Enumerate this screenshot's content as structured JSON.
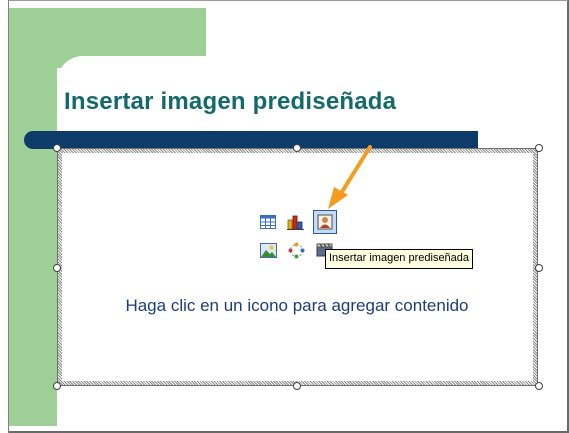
{
  "slide": {
    "title": "Insertar imagen prediseñada",
    "placeholder_text": "Haga clic en un icono para agregar contenido"
  },
  "content_icons": [
    {
      "name": "table",
      "icon": "table-icon"
    },
    {
      "name": "chart",
      "icon": "chart-icon"
    },
    {
      "name": "clip-art",
      "icon": "clip-art-icon"
    },
    {
      "name": "picture",
      "icon": "picture-icon"
    },
    {
      "name": "diagram",
      "icon": "diagram-icon"
    },
    {
      "name": "media",
      "icon": "media-clip-icon"
    }
  ],
  "tooltip": {
    "text": "Insertar imagen prediseñada"
  },
  "colors": {
    "accent_green": "#9ecf97",
    "title_teal": "#146a6a",
    "bar_navy": "#0e3c6a",
    "body_text_blue": "#1c3d78",
    "arrow_orange": "#f39c1f",
    "tooltip_bg": "#ffffe1"
  }
}
